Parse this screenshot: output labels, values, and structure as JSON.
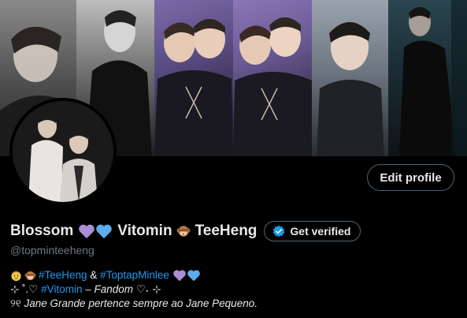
{
  "profile": {
    "display_name_1": "Blossom",
    "display_name_2": "Vitomin",
    "display_name_3": "TeeHeng",
    "handle": "@topminteeheng",
    "edit_profile_label": "Edit profile",
    "get_verified_label": "Get verified"
  },
  "bio": {
    "line1_tag1": "#TeeHeng",
    "line1_amp": " & ",
    "line1_tag2": "#ToptapMinlee",
    "line2_prefix": "⊹ ˚.♡ ",
    "line2_tag": "#Vitomin",
    "line2_suffix": " – Fandom ♡˖ ⊹",
    "line3_prefix": "୨୧ ",
    "line3_text": "Jane Grande pertence sempre ao Jane Pequeno."
  },
  "colors": {
    "accent": "#1d9bf0",
    "heart_purple": "#aa8ed6",
    "heart_blue": "#5dadec",
    "muted_text": "#71767b",
    "border": "#536471"
  },
  "icons": {
    "heart_purple": "purple-heart-icon",
    "heart_blue": "blue-heart-icon",
    "monkey": "monkey-icon",
    "verified_badge": "verified-badge-icon",
    "baby": "baby-icon"
  }
}
